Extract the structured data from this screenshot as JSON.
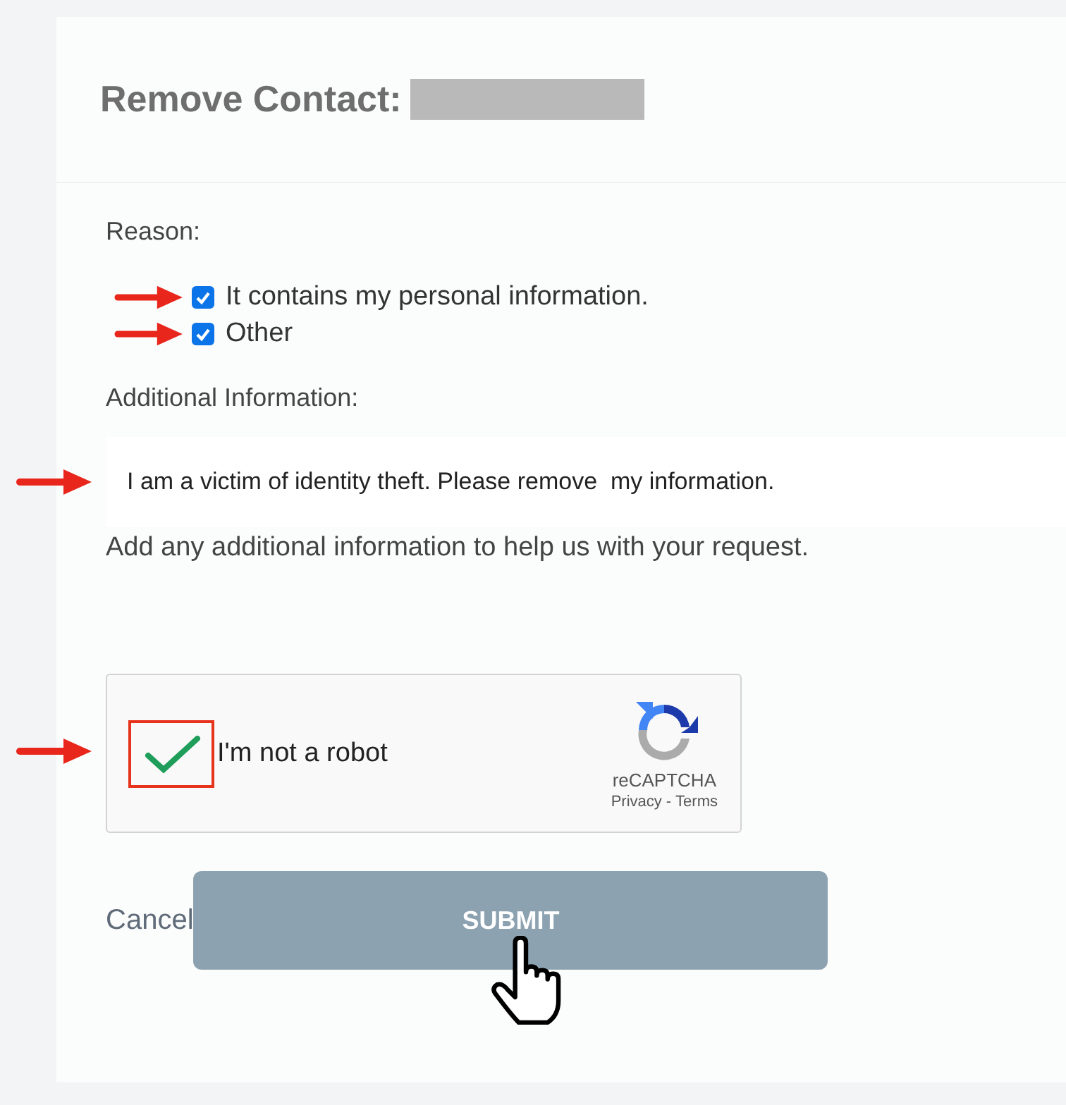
{
  "title": "Remove Contact:",
  "reason": {
    "label": "Reason:",
    "options": [
      {
        "label": "It contains my personal information.",
        "checked": true
      },
      {
        "label": "Other",
        "checked": true
      }
    ]
  },
  "additional": {
    "label": "Additional Information:",
    "value": "I am a victim of identity theft. Please remove  my information.",
    "help": "Add any additional information to help us with your request."
  },
  "captcha": {
    "label": "I'm not a robot",
    "checked": true,
    "brand": "reCAPTCHA",
    "privacy": "Privacy",
    "separator": "-",
    "terms": "Terms"
  },
  "actions": {
    "cancel": "Cancel",
    "submit": "SUBMIT"
  }
}
